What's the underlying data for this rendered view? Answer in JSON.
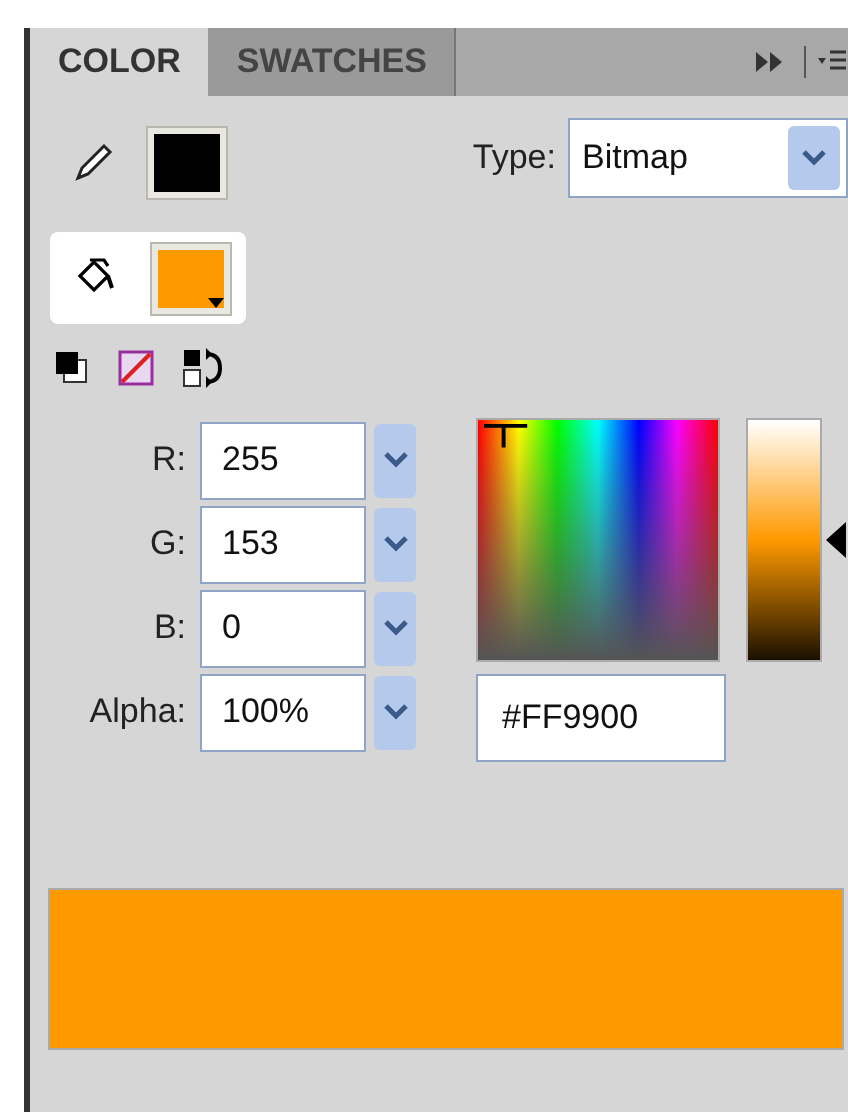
{
  "tabs": [
    {
      "label": "COLOR",
      "selected": true
    },
    {
      "label": "SWATCHES",
      "selected": false
    }
  ],
  "strokes": [
    {
      "kind": "stroke",
      "color": "#000000",
      "selected": false
    },
    {
      "kind": "fill",
      "color": "#ff9900",
      "selected": true
    }
  ],
  "type": {
    "label": "Type:",
    "value": "Bitmap"
  },
  "channels": [
    {
      "label": "R:",
      "value": "255"
    },
    {
      "label": "G:",
      "value": "153"
    },
    {
      "label": "B:",
      "value": "0"
    },
    {
      "label": "Alpha:",
      "value": "100%"
    }
  ],
  "hex": "#FF9900",
  "brightness": {
    "level": 0.5
  },
  "preview": {
    "color": "#ff9900"
  }
}
